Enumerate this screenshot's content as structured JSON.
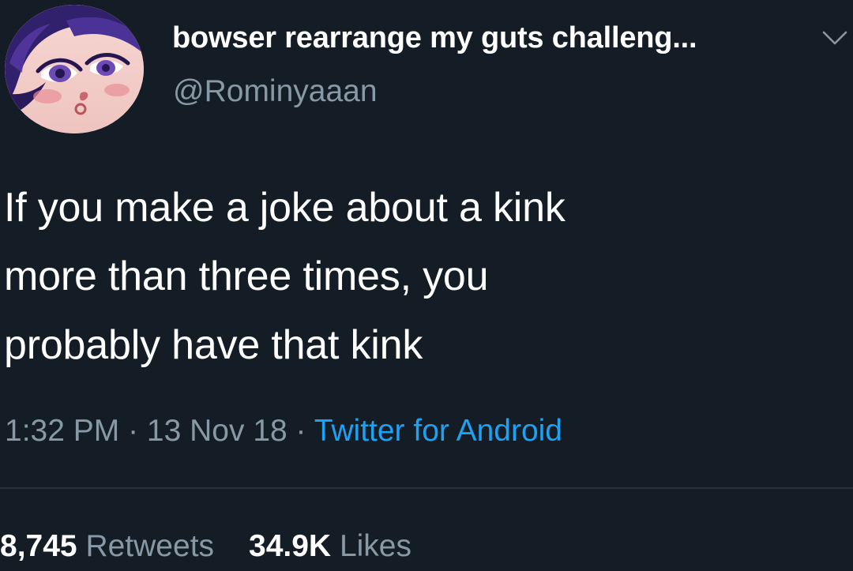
{
  "tweet": {
    "display_name": "bowser rearrange my guts challeng...",
    "handle": "@Rominyaaan",
    "text": "If you make a joke about a kink\nmore than three times, you\nprobably have that kink",
    "timestamp": "1:32 PM",
    "date": "13 Nov 18",
    "separator": " · ",
    "source": "Twitter for Android"
  },
  "stats": {
    "retweets_count": "8,745",
    "retweets_label": "Retweets",
    "likes_count": "34.9K",
    "likes_label": "Likes"
  },
  "icons": {
    "menu": "chevron-down-icon",
    "avatar": "avatar-illustration"
  },
  "colors": {
    "background": "#141d26",
    "primary_text": "#ffffff",
    "secondary_text": "#8899a6",
    "link": "#1da1f2",
    "divider": "#26323f"
  }
}
